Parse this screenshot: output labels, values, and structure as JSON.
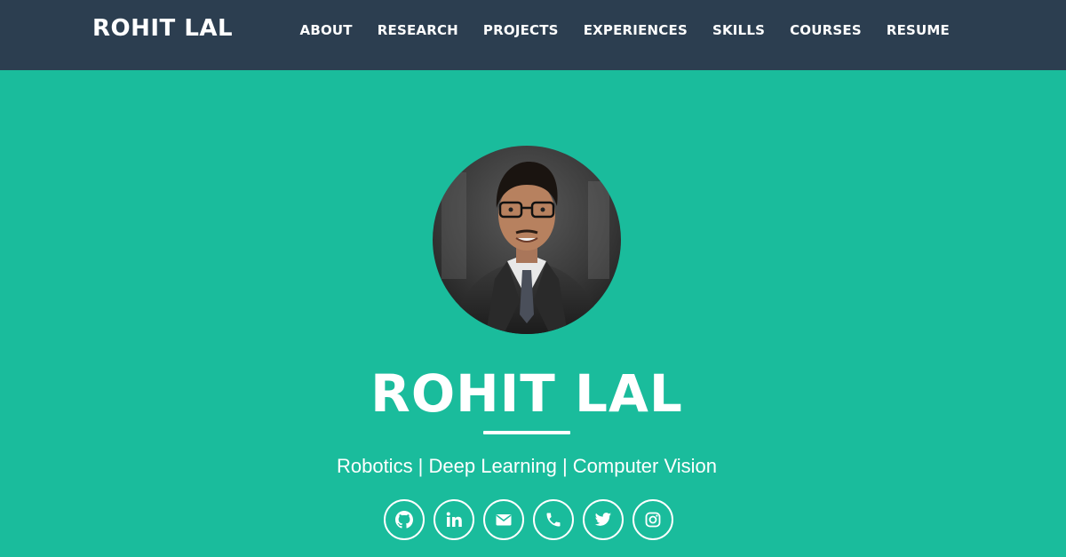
{
  "navbar": {
    "brand": "ROHIT LAL",
    "links": [
      "ABOUT",
      "RESEARCH",
      "PROJECTS",
      "EXPERIENCES",
      "SKILLS",
      "COURSES",
      "RESUME"
    ]
  },
  "hero": {
    "name": "ROHIT LAL",
    "tagline": "Robotics | Deep Learning | Computer Vision",
    "social_icons": [
      "github-icon",
      "linkedin-icon",
      "envelope-icon",
      "phone-icon",
      "twitter-icon",
      "instagram-icon"
    ]
  },
  "colors": {
    "navbar_bg": "#2c3e50",
    "hero_bg": "#1abc9c",
    "text": "#ffffff"
  }
}
